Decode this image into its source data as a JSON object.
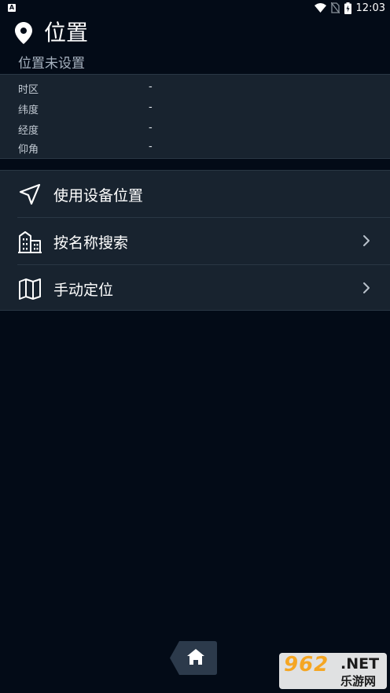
{
  "status_bar": {
    "notification_icon": "A",
    "time": "12:03",
    "icons": [
      "wifi-icon",
      "no-sim-icon",
      "battery-charging-icon"
    ]
  },
  "header": {
    "title": "位置",
    "subtitle": "位置未设置",
    "icon": "location-pin-icon"
  },
  "info": [
    {
      "label": "时区",
      "value": "-"
    },
    {
      "label": "纬度",
      "value": "-"
    },
    {
      "label": "经度",
      "value": "-"
    },
    {
      "label": "仰角",
      "value": "-"
    }
  ],
  "menu": [
    {
      "label": "使用设备位置",
      "icon": "navigation-arrow-icon",
      "has_chevron": false
    },
    {
      "label": "按名称搜索",
      "icon": "buildings-icon",
      "has_chevron": true
    },
    {
      "label": "手动定位",
      "icon": "map-icon",
      "has_chevron": true
    }
  ],
  "bottom": {
    "home_icon": "home-icon"
  },
  "watermark": {
    "digits": "962",
    "net": ".NET",
    "cn": "乐游网"
  },
  "colors": {
    "background": "#030b17",
    "panel": "#18232f",
    "divider": "#2a3744",
    "subtitle": "#a7b2bf",
    "home_button": "#2c3a4b"
  }
}
